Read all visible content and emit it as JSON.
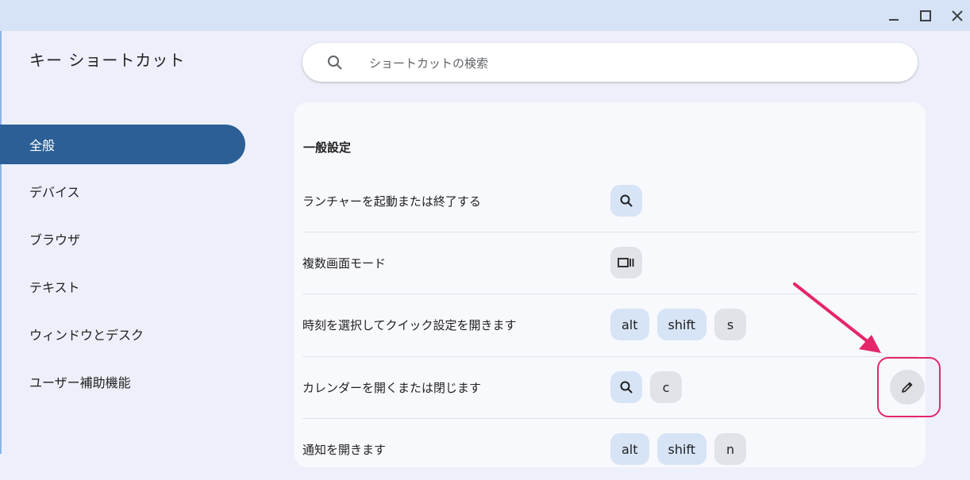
{
  "window": {
    "minimize_icon": "minimize-icon",
    "maximize_icon": "maximize-icon",
    "close_icon": "close-icon"
  },
  "app": {
    "title": "キー ショートカット"
  },
  "sidebar": {
    "items": [
      {
        "label": "全般",
        "active": true
      },
      {
        "label": "デバイス"
      },
      {
        "label": "ブラウザ"
      },
      {
        "label": "テキスト"
      },
      {
        "label": "ウィンドウとデスク"
      },
      {
        "label": "ユーザー補助機能"
      }
    ]
  },
  "search": {
    "placeholder": "ショートカットの検索",
    "value": ""
  },
  "section": {
    "title": "一般設定",
    "rows": [
      {
        "label": "ランチャーを起動または終了する",
        "keys": [
          "search-icon"
        ]
      },
      {
        "label": "複数画面モード",
        "keys": [
          "overview-icon"
        ]
      },
      {
        "label": "時刻を選択してクイック設定を開きます",
        "keys": [
          "alt",
          "shift",
          "s"
        ]
      },
      {
        "label": "カレンダーを開くまたは閉じます",
        "keys": [
          "search-icon",
          "c"
        ]
      },
      {
        "label": "通知を開きます",
        "keys": [
          "alt",
          "shift",
          "n"
        ]
      }
    ]
  },
  "edit_button": {
    "icon": "pencil-icon"
  },
  "annotation": {
    "color": "#e5266b"
  },
  "colors": {
    "accent": "#2b5f96",
    "key_modifier_bg": "#d6e4f6",
    "key_plain_bg": "#e2e3e8"
  }
}
